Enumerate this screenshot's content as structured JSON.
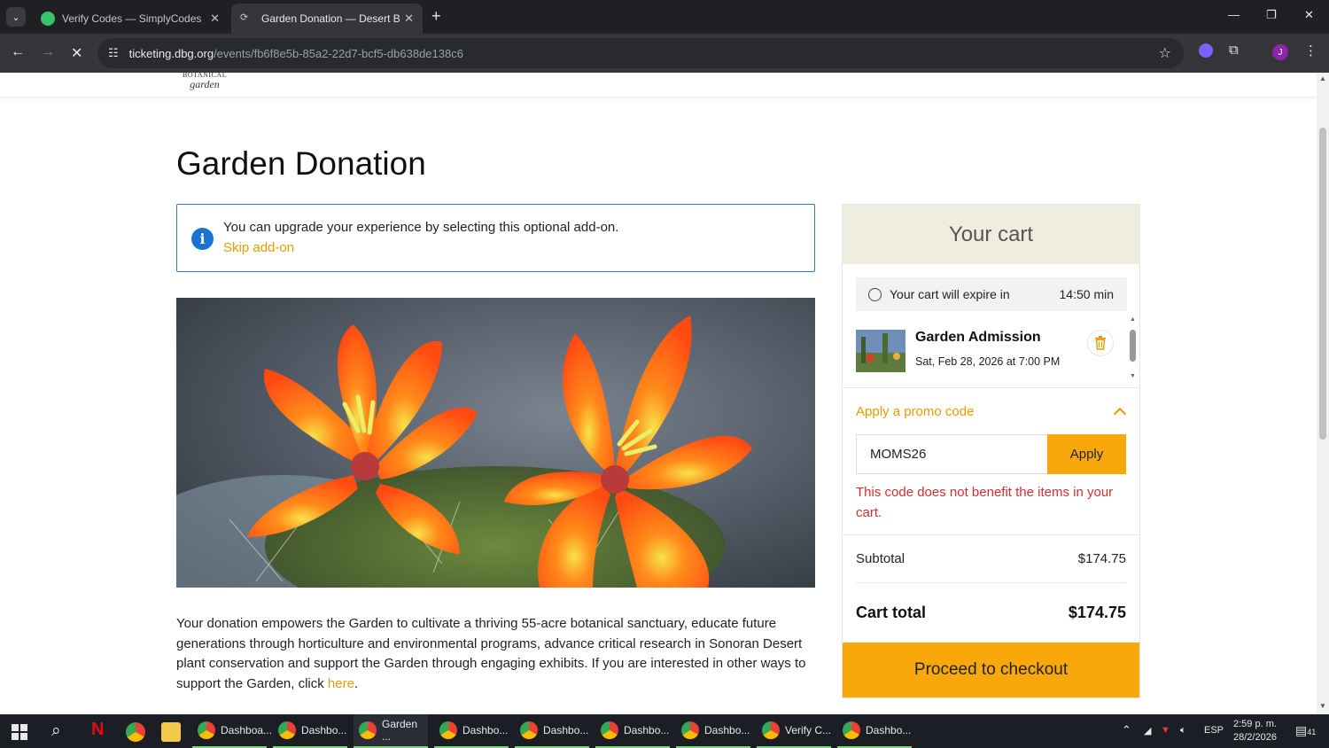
{
  "browser": {
    "tabs": [
      {
        "title": "Verify Codes — SimplyCodes",
        "active": false
      },
      {
        "title": "Garden Donation — Desert Bot",
        "active": true
      }
    ],
    "url_host": "ticketing.dbg.org",
    "url_path": "/events/fb6f8e5b-85a2-22d7-bcf5-db638de138c6",
    "profile_initial": "J"
  },
  "site": {
    "logo_line1": "BOTANICAL",
    "logo_line2": "garden"
  },
  "page": {
    "title": "Garden Donation",
    "notice": {
      "message": "You can upgrade your experience by selecting this optional add-on.",
      "skip_link": "Skip add-on"
    },
    "description": "Your donation empowers the Garden to cultivate a thriving 55-acre botanical sanctuary, educate future generations through horticulture and environmental programs, advance critical research in Sonoran Desert plant conservation and support the Garden through engaging exhibits. If you are interested in other ways to support the Garden, click ",
    "description_link": "here",
    "description_end": "."
  },
  "cart": {
    "heading": "Your cart",
    "expire_label": "Your cart will expire in",
    "expire_time": "14:50 min",
    "item": {
      "name": "Garden Admission",
      "date": "Sat, Feb 28, 2026 at 7:00 PM"
    },
    "promo_toggle": "Apply a promo code",
    "promo_value": "MOMS26",
    "apply_label": "Apply",
    "promo_error": "This code does not benefit the items in your cart.",
    "subtotal_label": "Subtotal",
    "subtotal": "$174.75",
    "total_label": "Cart total",
    "total": "$174.75",
    "checkout_label": "Proceed to checkout"
  },
  "taskbar": {
    "apps": [
      {
        "label": "Dashboa...",
        "active": false
      },
      {
        "label": "Dashbo...",
        "active": false
      },
      {
        "label": "Garden ...",
        "active": true
      },
      {
        "label": "Dashbo...",
        "active": false
      },
      {
        "label": "Dashbo...",
        "active": false
      },
      {
        "label": "Dashbo...",
        "active": false
      },
      {
        "label": "Dashbo...",
        "active": false
      },
      {
        "label": "Verify C...",
        "active": false
      },
      {
        "label": "Dashbo...",
        "active": false
      }
    ],
    "language": "ESP",
    "time": "2:59 p. m.",
    "date": "28/2/2026",
    "notifications": "41"
  },
  "colors": {
    "accent": "#f9a80c",
    "link": "#e89b00",
    "info": "#1a73d1",
    "error": "#d32f2f",
    "cart_header_bg": "#efece0"
  }
}
